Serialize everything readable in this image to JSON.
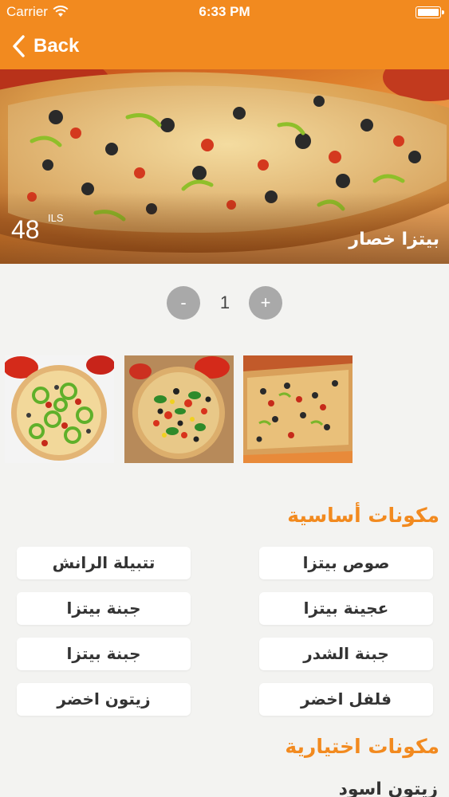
{
  "status_bar": {
    "carrier": "Carrier",
    "time": "6:33 PM",
    "wifi_icon": "wifi-icon",
    "battery_icon": "battery-icon"
  },
  "nav": {
    "back_label": "Back",
    "back_icon": "chevron-left-icon"
  },
  "product": {
    "name": "بيتزا خصار",
    "price": "48",
    "currency": "ILS"
  },
  "quantity": {
    "minus_label": "-",
    "value": "1",
    "plus_label": "+"
  },
  "gallery": {
    "thumbnails": [
      "pizza-photo-1",
      "pizza-photo-2",
      "pizza-photo-3"
    ]
  },
  "basic_ingredients": {
    "title": "مكونات أساسية",
    "items": [
      "صوص بيتزا",
      "تتبيلة الرانش",
      "عجينة بيتزا",
      "جبنة بيتزا",
      "جبنة الشدر",
      "جبنة بيتزا",
      "فلفل اخضر",
      "زيتون اخضر"
    ]
  },
  "optional_ingredients": {
    "title": "مكونات اختيارية",
    "items": [
      "زيتون اسود"
    ]
  },
  "colors": {
    "accent": "#f28a1f",
    "background": "#f3f3f1",
    "qty_button": "#a9a9a9"
  }
}
